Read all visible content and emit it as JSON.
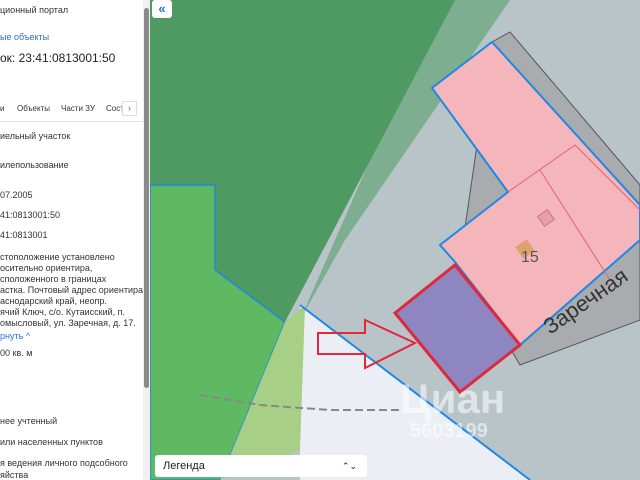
{
  "panel": {
    "portal": "ционный портал",
    "link": "ые объекты",
    "title": "ок: 23:41:0813001:50",
    "tabs": [
      "и",
      "Объекты",
      "Части ЗУ",
      "Сост"
    ],
    "tab_next": "›",
    "lines": [
      "иельный участок",
      "илепользование",
      "07.2005",
      "41:0813001:50",
      "41:0813001"
    ],
    "address": [
      "стоположение установлено",
      "осительно ориентира,",
      "сположенного в границах",
      "астка. Почтовый адрес ориентира:",
      "аснодарский край, неопр.",
      "ячий Ключ, с/о. Кутаисский, п.",
      "омысловый, ул. Заречная, д. 17."
    ],
    "collapse_link": "рнуть",
    "area": "00 кв. м",
    "lines2": [
      "нее учтенный",
      "или населенных пунктов",
      "я ведения личного подсобного",
      "яйства"
    ]
  },
  "map": {
    "collapse": "«",
    "legend": "Легенда",
    "parcel_number": "15",
    "street": "Заречная",
    "watermark": "Циан",
    "watermark_id": "5603199"
  },
  "colors": {
    "accent": "#2a6fd6",
    "parcel_pink": "#f4b6bb",
    "selected": "#8e86c0",
    "outline": "#e0283c"
  }
}
